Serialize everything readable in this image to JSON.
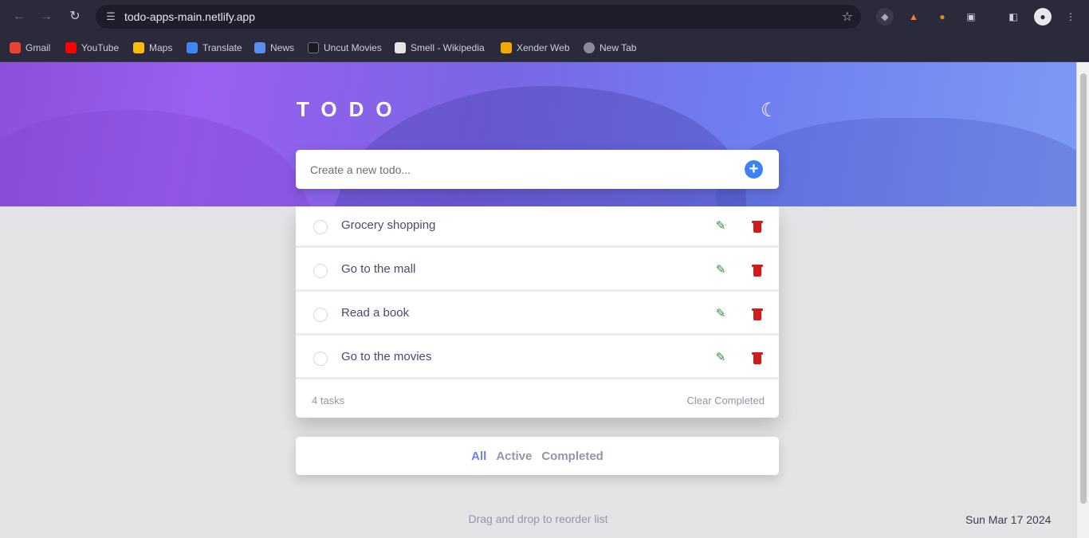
{
  "browser": {
    "url": "todo-apps-main.netlify.app",
    "bookmarks": [
      {
        "label": "Gmail",
        "color": "#ea4335"
      },
      {
        "label": "YouTube",
        "color": "#ff0000"
      },
      {
        "label": "Maps",
        "color": "#fbbc04"
      },
      {
        "label": "Translate",
        "color": "#4285f4"
      },
      {
        "label": "News",
        "color": "#5b8def"
      },
      {
        "label": "Uncut Movies",
        "color": "#2d2d3a"
      },
      {
        "label": "Smell - Wikipedia",
        "color": "#e5e5e5"
      },
      {
        "label": "Xender Web",
        "color": "#f2a900"
      },
      {
        "label": "New Tab",
        "color": "#8a8a9a"
      }
    ]
  },
  "app": {
    "title": "TODO",
    "theme_icon": "moon-icon",
    "new_todo_placeholder": "Create a new todo...",
    "todos": [
      {
        "text": "Grocery shopping",
        "completed": false
      },
      {
        "text": "Go to the mall",
        "completed": false
      },
      {
        "text": "Read a book",
        "completed": false
      },
      {
        "text": "Go to the movies",
        "completed": false
      }
    ],
    "items_left": "4 tasks",
    "clear_completed": "Clear Completed",
    "filters": {
      "all": "All",
      "active": "Active",
      "completed": "Completed",
      "selected": "All"
    },
    "hint": "Drag and drop to reorder list",
    "date": "Sun Mar 17 2024"
  },
  "colors": {
    "accent": "#3b82f6",
    "edit": "#2e8b3c",
    "delete": "#d21a1a",
    "active_filter": "#6f7ff0"
  }
}
